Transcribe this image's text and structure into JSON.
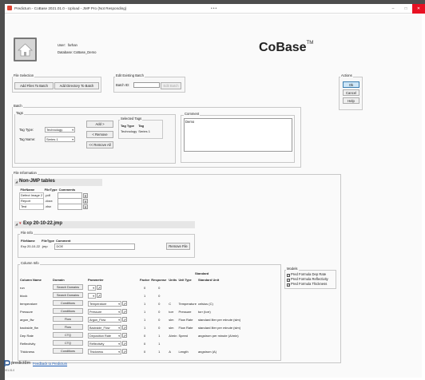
{
  "window": {
    "title": "Predictum - CoBase 2021.01.0 - Upload - JMP Pro (Not Responding)",
    "dots": "•••",
    "min_icon": "–",
    "max_icon": "□",
    "close_icon": "✕"
  },
  "user": {
    "user_label": "User:",
    "user_value": "farhan",
    "db_label": "Database:",
    "db_value": "CoBase_Demo"
  },
  "logo": {
    "text": "CoBase",
    "tm": "TM"
  },
  "file_selection": {
    "title": "File Selection",
    "add_files": "Add Files To Batch",
    "add_dir": "Add Directory To Batch"
  },
  "edit_batch": {
    "title": "Edit Existing Batch",
    "batch_id_label": "Batch ID:",
    "edit_btn": "Edit Batch"
  },
  "actions": {
    "title": "Actions",
    "ok": "Ok",
    "cancel": "Cancel",
    "help": "Help"
  },
  "batch": {
    "title": "Batch",
    "tags_title": "Tags",
    "tag_type_label": "Tag Type:",
    "tag_type_value": "Technology",
    "tag_name_label": "Tag Name:",
    "tag_name_value": "Series 1",
    "add": "Add >",
    "remove": "< Remove",
    "remove_all": "<< Remove All",
    "selected_tags_title": "Selected Tags",
    "selected_headers": [
      "Tag Type",
      "Tag"
    ],
    "selected_rows": [
      [
        "Technology",
        "Series 1"
      ]
    ],
    "comment_title": "Comment",
    "comment_value": "Demo"
  },
  "file_information": {
    "title": "File Information",
    "non_jmp_title": "Non-JMP tables",
    "non_jmp_headers": [
      "FileName",
      "FileType",
      "Comments"
    ],
    "non_jmp_rows": [
      [
        "Defect Image 2",
        ".pdf"
      ],
      [
        "Report",
        ".docx"
      ],
      [
        "Test",
        ".xlsx"
      ]
    ],
    "exp_title": "Exp 20-10-22.jmp",
    "file_info_title": "File Info",
    "file_info_headers": [
      "FileName",
      "FileType",
      "Comment"
    ],
    "file_info_rows": [
      [
        "Exp 20-10-22",
        ".jmp",
        "DOE"
      ]
    ],
    "remove_file": "Remove File",
    "column_info_title": "Column Info",
    "column_headers": [
      "Column Name",
      "Domain",
      "Parameter",
      "Factor",
      "Response",
      "Units",
      "Standard Unit Type",
      "Standard Unit"
    ],
    "columns": [
      {
        "name": "run",
        "domain": "Search Domains",
        "parameter": "",
        "factor": "0",
        "response": "0",
        "units": "",
        "unit_type": "",
        "std_unit": ""
      },
      {
        "name": "block",
        "domain": "Search Domains",
        "parameter": "",
        "factor": "1",
        "response": "0",
        "units": "",
        "unit_type": "",
        "std_unit": ""
      },
      {
        "name": "temperature",
        "domain": "Conditions",
        "parameter": "Temperature",
        "factor": "1",
        "response": "0",
        "units": "C",
        "unit_type": "Temperature",
        "std_unit": "celsius (C)"
      },
      {
        "name": "Pressure",
        "domain": "Conditions",
        "parameter": "Pressure",
        "factor": "1",
        "response": "0",
        "units": "torr",
        "unit_type": "Pressure",
        "std_unit": "torr (torr)"
      },
      {
        "name": "argon_flw",
        "domain": "Flow",
        "parameter": "Argon_Flow",
        "factor": "1",
        "response": "0",
        "units": "slm",
        "unit_type": "Flow Rate",
        "std_unit": "standard liter per minute (slm)"
      },
      {
        "name": "backside_flw",
        "domain": "Flow",
        "parameter": "Backside_Flow",
        "factor": "1",
        "response": "0",
        "units": "slm",
        "unit_type": "Flow Rate",
        "std_unit": "standard liter per minute (slm)"
      },
      {
        "name": "Dep Rate",
        "domain": "CTQ",
        "parameter": "Deposition Rate",
        "factor": "0",
        "response": "1",
        "units": "A/min",
        "unit_type": "Speed",
        "std_unit": "angstrom per minute (A/min)"
      },
      {
        "name": "Reflectivity",
        "domain": "CTQ",
        "parameter": "Reflectivity",
        "factor": "0",
        "response": "1",
        "units": "",
        "unit_type": "",
        "std_unit": ""
      },
      {
        "name": "Thickness",
        "domain": "Conditions",
        "parameter": "Thickness",
        "factor": "0",
        "response": "1",
        "units": "A",
        "unit_type": "Length",
        "std_unit": "angstrom (A)"
      }
    ],
    "models_title": "Models",
    "models": [
      "Pred Formula Dep Rate",
      "Pred Formula Reflectivity",
      "Pred Formula Thickness"
    ]
  },
  "footer": {
    "brand": "predictum",
    "link": "Feedback to Predictum",
    "version": "2021.01.0"
  }
}
